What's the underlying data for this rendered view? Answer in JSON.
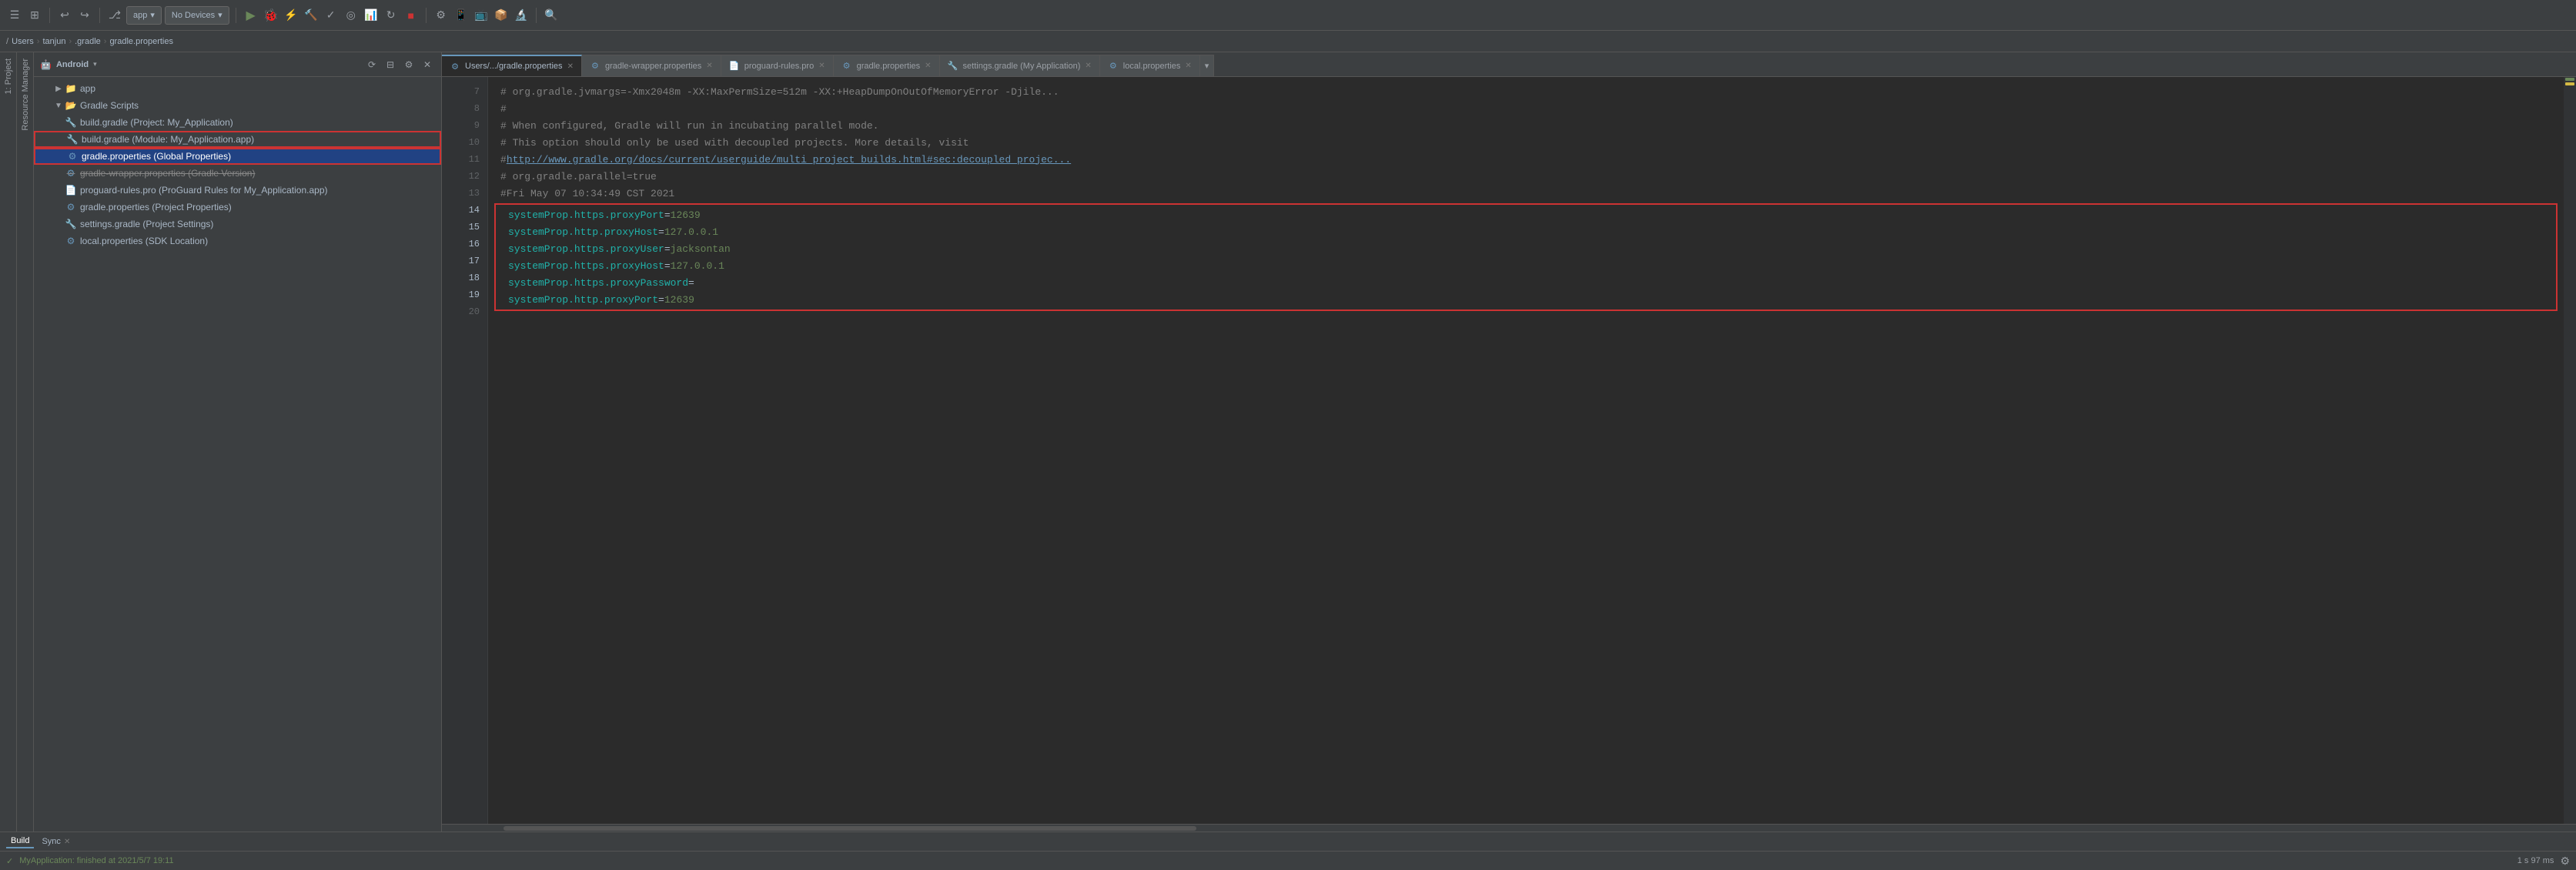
{
  "toolbar": {
    "app_label": "app",
    "no_devices_label": "No Devices",
    "icons": [
      "menu",
      "layout",
      "undo",
      "redo",
      "vcs",
      "dropdown",
      "run",
      "debug",
      "attach",
      "build",
      "test",
      "coverage",
      "profile",
      "reload",
      "stop",
      "sdk",
      "logcat",
      "monitor",
      "apk",
      "profiler",
      "search"
    ]
  },
  "breadcrumb": {
    "items": [
      "Users",
      "tanjun",
      ".gradle",
      "gradle.properties"
    ]
  },
  "project_panel": {
    "title": "Android",
    "items": [
      {
        "label": "app",
        "type": "folder",
        "indent": 1,
        "expanded": true
      },
      {
        "label": "Gradle Scripts",
        "type": "folder",
        "indent": 1,
        "expanded": true
      },
      {
        "label": "build.gradle (Project: My_Application)",
        "type": "gradle",
        "indent": 2
      },
      {
        "label": "build.gradle (Module: My_Application.app)",
        "type": "gradle",
        "indent": 2
      },
      {
        "label": "gradle.properties (Global Properties)",
        "type": "properties",
        "indent": 2,
        "selected": true,
        "highlighted": true
      },
      {
        "label": "gradle-wrapper.properties (Gradle Version)",
        "type": "properties",
        "indent": 2,
        "highlighted_box": true
      },
      {
        "label": "proguard-rules.pro (ProGuard Rules for My_Application.app)",
        "type": "file",
        "indent": 2
      },
      {
        "label": "gradle.properties (Project Properties)",
        "type": "properties",
        "indent": 2
      },
      {
        "label": "settings.gradle (Project Settings)",
        "type": "gradle",
        "indent": 2
      },
      {
        "label": "local.properties (SDK Location)",
        "type": "properties",
        "indent": 2
      }
    ]
  },
  "tabs": [
    {
      "label": "Users/.../gradle.properties",
      "active": true,
      "icon": "properties"
    },
    {
      "label": "gradle-wrapper.properties",
      "active": false,
      "icon": "properties"
    },
    {
      "label": "proguard-rules.pro",
      "active": false,
      "icon": "file"
    },
    {
      "label": "gradle.properties",
      "active": false,
      "icon": "properties"
    },
    {
      "label": "settings.gradle (My Application)",
      "active": false,
      "icon": "gradle"
    },
    {
      "label": "local.properties",
      "active": false,
      "icon": "properties"
    }
  ],
  "editor": {
    "lines": [
      {
        "num": 7,
        "content": "# org.gradle.jvmargs=-Xmx2048m -XX:MaxPermSize=512m -XX:+HeapDumpOnOutOfMemoryError -Djile...",
        "type": "comment"
      },
      {
        "num": 8,
        "content": "#",
        "type": "comment"
      },
      {
        "num": 9,
        "content": "# When configured, Gradle will run in incubating parallel mode.",
        "type": "comment"
      },
      {
        "num": 10,
        "content": "# This option should only be used with decoupled projects. More details, visit",
        "type": "comment"
      },
      {
        "num": 11,
        "content": "# http://www.gradle.org/docs/current/userguide/multi_project_builds.html#sec:decoupled_projec...",
        "type": "link"
      },
      {
        "num": 12,
        "content": "# org.gradle.parallel=true",
        "type": "comment"
      },
      {
        "num": 13,
        "content": "#Fri May 07 10:34:49 CST 2021",
        "type": "comment"
      },
      {
        "num": 14,
        "content": "systemProp.https.proxyPort=12639",
        "type": "prop",
        "key": "systemProp.https.proxyPort",
        "val": "12639",
        "in_box": true
      },
      {
        "num": 15,
        "content": "systemProp.http.proxyHost=127.0.0.1",
        "type": "prop",
        "key": "systemProp.http.proxyHost",
        "val": "127.0.0.1",
        "in_box": true
      },
      {
        "num": 16,
        "content": "systemProp.https.proxyUser=jacksontan",
        "type": "prop",
        "key": "systemProp.https.proxyUser",
        "val": "jacksontan",
        "in_box": true
      },
      {
        "num": 17,
        "content": "systemProp.https.proxyHost=127.0.0.1",
        "type": "prop",
        "key": "systemProp.https.proxyHost",
        "val": "127.0.0.1",
        "in_box": true
      },
      {
        "num": 18,
        "content": "systemProp.https.proxyPassword=",
        "type": "prop",
        "key": "systemProp.https.proxyPassword",
        "val": "",
        "in_box": true
      },
      {
        "num": 19,
        "content": "systemProp.http.proxyPort=12639",
        "type": "prop",
        "key": "systemProp.http.proxyPort",
        "val": "12639",
        "in_box": true
      },
      {
        "num": 20,
        "content": "",
        "type": "empty"
      }
    ]
  },
  "bottom": {
    "tab_label": "Build",
    "sync_label": "Sync",
    "status_text": "MyApplication: finished at 2021/5/7 19:11",
    "duration": "1 s 97 ms"
  },
  "colors": {
    "accent_blue": "#6897bb",
    "accent_green": "#6a8759",
    "accent_yellow": "#d4b943",
    "red_border": "#cc3333",
    "selected_bg": "#214283",
    "editor_bg": "#2b2b2b",
    "sidebar_bg": "#3c3f41"
  }
}
